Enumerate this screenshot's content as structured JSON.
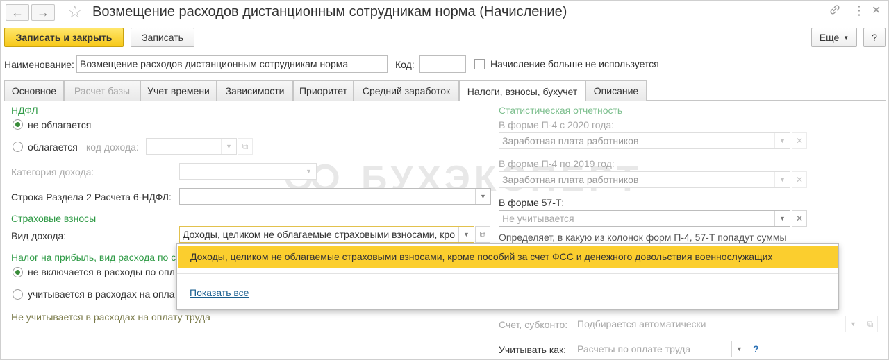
{
  "window": {
    "title": "Возмещение расходов дистанционным сотрудникам норма (Начисление)",
    "back_glyph": "←",
    "forward_glyph": "→",
    "star_glyph": "☆",
    "link_glyph": "🔗",
    "menu_glyph": "⋮",
    "close_glyph": "✕"
  },
  "toolbar": {
    "save_close_label": "Записать и закрыть",
    "save_label": "Записать",
    "more_label": "Еще",
    "help_label": "?"
  },
  "header": {
    "name_label": "Наименование:",
    "name_value": "Возмещение расходов дистанционным сотрудникам норма",
    "code_label": "Код:",
    "code_value": "",
    "unused_label": "Начисление больше не используется"
  },
  "tabs": [
    {
      "label": "Основное"
    },
    {
      "label": "Расчет базы"
    },
    {
      "label": "Учет времени"
    },
    {
      "label": "Зависимости"
    },
    {
      "label": "Приоритет"
    },
    {
      "label": "Средний заработок"
    },
    {
      "label": "Налоги, взносы, бухучет"
    },
    {
      "label": "Описание"
    }
  ],
  "ndfl": {
    "section": "НДФЛ",
    "not_taxed": "не облагается",
    "taxed": "облагается",
    "income_code_label": "код дохода:",
    "income_category_label": "Категория дохода:",
    "row_6ndfl_label": "Строка Раздела 2 Расчета 6-НДФЛ:"
  },
  "insurance": {
    "section": "Страховые взносы",
    "income_type_label": "Вид дохода:",
    "income_type_value": "Доходы, целиком не облагаемые страховыми взносами, кро"
  },
  "profit_tax": {
    "section": "Налог на прибыль, вид расхода по с",
    "not_included": "не включается в расходы по опл",
    "included": "учитывается в расходах на опла",
    "note": "Не учитывается в расходах на оплату труда"
  },
  "stats": {
    "section": "Статистическая отчетность",
    "p4_2020_label": "В форме П-4 с 2020 года:",
    "p4_2020_value": "Заработная плата работников",
    "p4_2019_label": "В форме П-4 по 2019 год:",
    "p4_2019_value": "Заработная плата работников",
    "f57t_label": "В форме 57-Т:",
    "f57t_placeholder": "Не учитывается",
    "hint": "Определяет, в какую из колонок форм П-4, 57-Т попадут суммы"
  },
  "accounting": {
    "account_label": "Счет, субконто:",
    "account_placeholder": "Подбирается автоматически",
    "count_as_label": "Учитывать как:",
    "count_as_placeholder": "Расчеты по оплате труда",
    "help": "?"
  },
  "popup": {
    "item": "Доходы, целиком не облагаемые страховыми взносами, кроме пособий за счет ФСС и денежного довольствия военнослужащих",
    "show_all": "Показать все"
  },
  "watermark": {
    "text": "БУХЭКСПЕРТ"
  },
  "colors": {
    "accent_yellow": "#fbce2e",
    "section_green": "#2e9a45",
    "link_blue": "#1a5f8f"
  }
}
